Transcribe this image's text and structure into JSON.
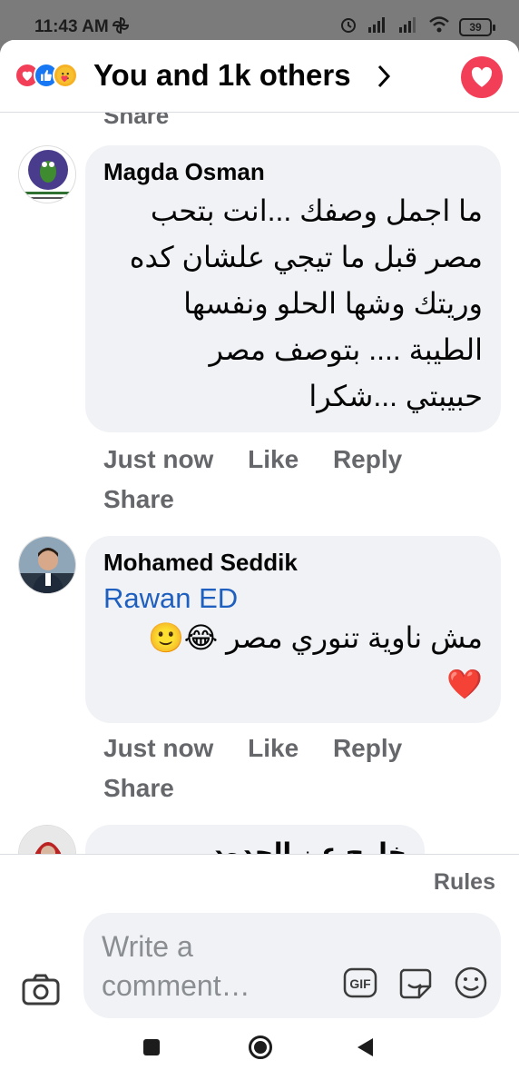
{
  "status_bar": {
    "time": "11:43 AM",
    "battery": "39"
  },
  "header": {
    "title": "You and 1k others"
  },
  "feed": {
    "partial_action": "Share",
    "comments": [
      {
        "author": "Magda Osman",
        "lines": [
          "ما اجمل وصفك ...انت بتحب",
          "مصر قبل ما تيجي علشان كده",
          "وريتك وشها الحلو ونفسها",
          "الطيبة .... بتوصف مصر",
          "حبيبتي ...شكرا"
        ],
        "time": "Just now",
        "like": "Like",
        "reply": "Reply",
        "share": "Share"
      },
      {
        "author": "Mohamed Seddik",
        "tag": "Rawan ED",
        "lines": [
          "مش ناوية تنوري مصر 😂🙂",
          "❤️"
        ],
        "time": "Just now",
        "like": "Like",
        "reply": "Reply",
        "share": "Share"
      },
      {
        "partial_text": "خارج عن الحدود"
      }
    ]
  },
  "composer": {
    "rules": "Rules",
    "placeholder": "Write a comment…",
    "gif": "GIF"
  },
  "colors": {
    "love": "#f33e58",
    "like": "#1877f2",
    "care": "#f7b125",
    "link": "#1f5fbf",
    "bubble": "#f0f2f5",
    "meta": "#65676b"
  },
  "icons": [
    "love-reaction-icon",
    "like-reaction-icon",
    "care-reaction-icon",
    "chevron-right-icon",
    "heart-icon",
    "camera-icon",
    "gif-icon",
    "sticker-icon",
    "emoji-icon"
  ]
}
